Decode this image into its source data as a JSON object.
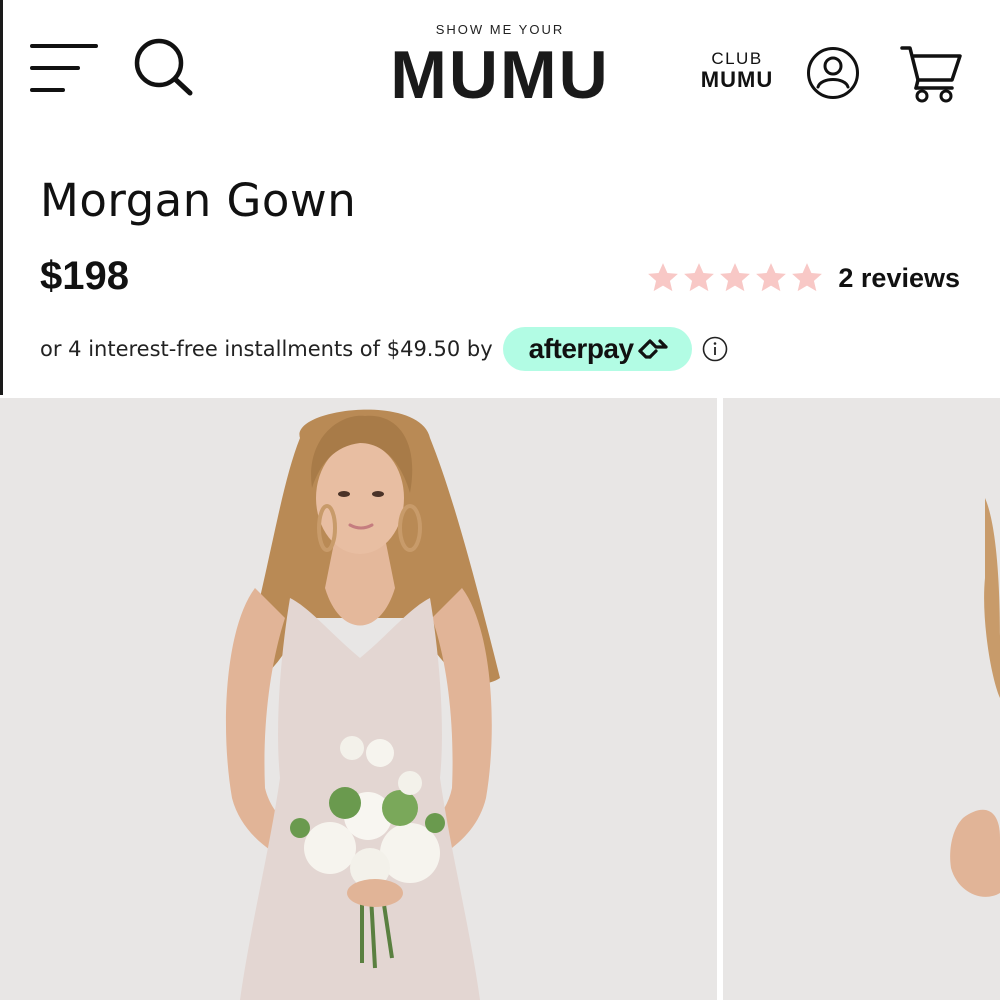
{
  "header": {
    "logo_small": "SHOW ME YOUR",
    "logo_big": "MUMU",
    "club_top": "CLUB",
    "club_bottom": "MUMU",
    "icons": [
      "menu-icon",
      "search-icon",
      "account-icon",
      "cart-icon"
    ]
  },
  "product": {
    "title": "Morgan Gown",
    "price": "$198",
    "rating": 5,
    "rating_max": 5,
    "reviews_label": "2 reviews",
    "installments_text": "or 4 interest-free installments of $49.50 by",
    "afterpay_label": "afterpay"
  },
  "colors": {
    "star": "#f8c8c6",
    "afterpay_bg": "#b2fce4",
    "photo_bg": "#e8e6e5",
    "dress": "#e3d6d2"
  },
  "gallery": {
    "images": [
      "model-in-blush-gown-holding-bouquet",
      "model-side-view"
    ]
  }
}
